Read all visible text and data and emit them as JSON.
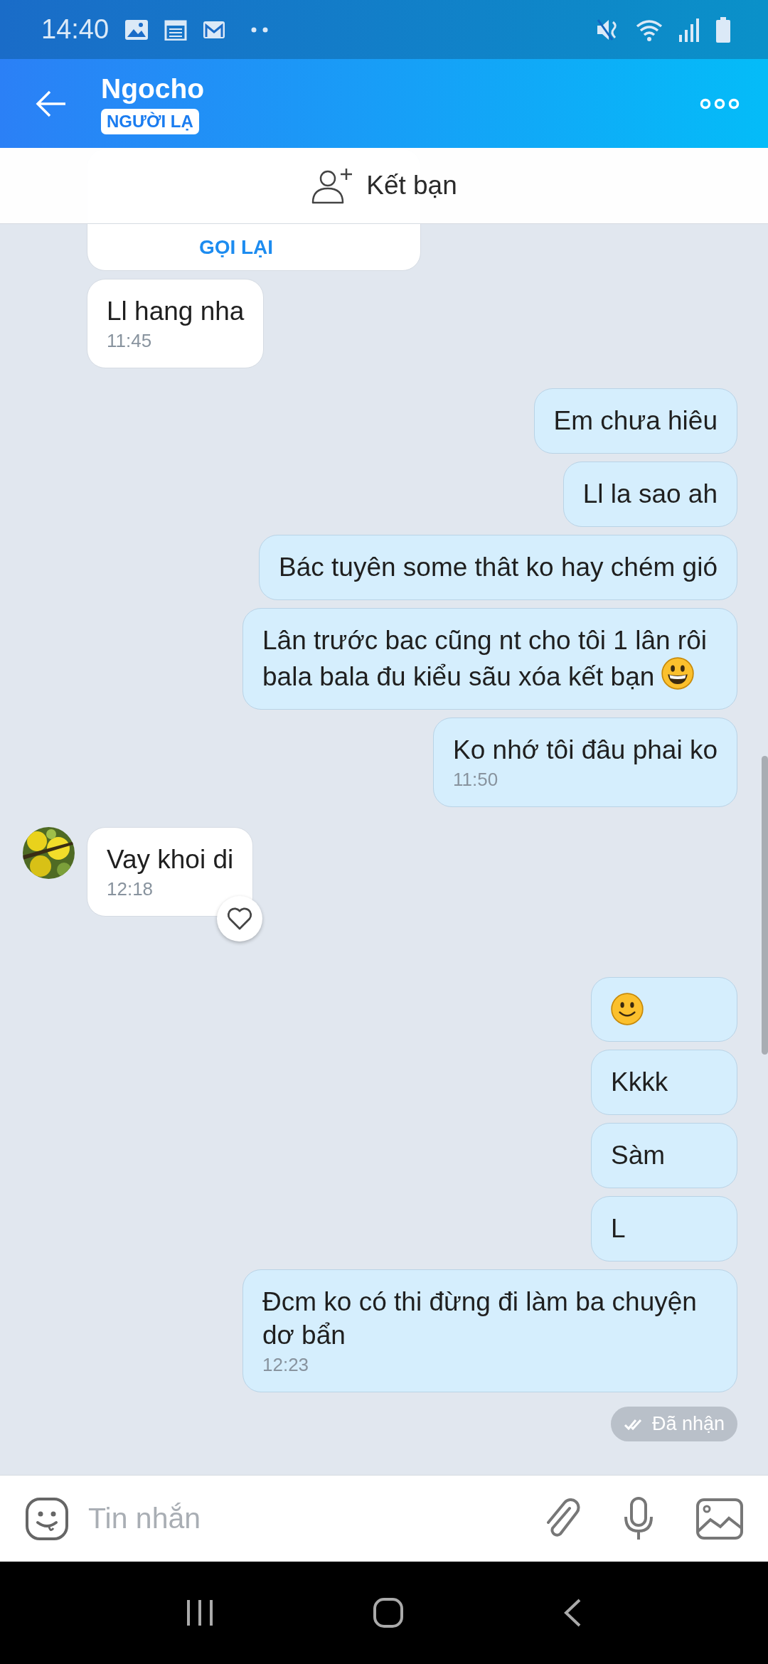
{
  "status_bar": {
    "time": "14:40"
  },
  "header": {
    "name": "Ngocho",
    "tag": "NGƯỜI LẠ"
  },
  "friend_bar": {
    "label": "Kết bạn"
  },
  "messages": [
    {
      "kind": "call",
      "outgoing": false,
      "action": "GỌI LẠI"
    },
    {
      "kind": "text",
      "outgoing": false,
      "text": "Ll hang nha",
      "time": "11:45"
    },
    {
      "kind": "text",
      "outgoing": true,
      "text": "Em chưa hiêu"
    },
    {
      "kind": "text",
      "outgoing": true,
      "text": "Ll la sao ah"
    },
    {
      "kind": "text",
      "outgoing": true,
      "text": "Bác tuyên some thât ko hay chém gió"
    },
    {
      "kind": "text",
      "outgoing": true,
      "text": "Lân trước bac cũng nt cho tôi 1 lân rôi bala bala đu kiểu sãu xóa kết bạn",
      "trailing_emoji": true
    },
    {
      "kind": "text",
      "outgoing": true,
      "text": "Ko nhớ tôi đâu phai ko",
      "time": "11:50"
    },
    {
      "kind": "text",
      "outgoing": false,
      "text": "Vay khoi di",
      "time": "12:18",
      "avatar": true,
      "react_button": true
    },
    {
      "kind": "emoji",
      "outgoing": true
    },
    {
      "kind": "text",
      "outgoing": true,
      "text": "Kkkk"
    },
    {
      "kind": "text",
      "outgoing": true,
      "text": "Sàm"
    },
    {
      "kind": "text",
      "outgoing": true,
      "text": "L"
    },
    {
      "kind": "text",
      "outgoing": true,
      "text": "Đcm ko có thi đừng đi làm ba chuyện dơ bẩn",
      "time": "12:23"
    }
  ],
  "receipt": {
    "label": "Đã nhận"
  },
  "composer": {
    "placeholder": "Tin nhắn"
  }
}
